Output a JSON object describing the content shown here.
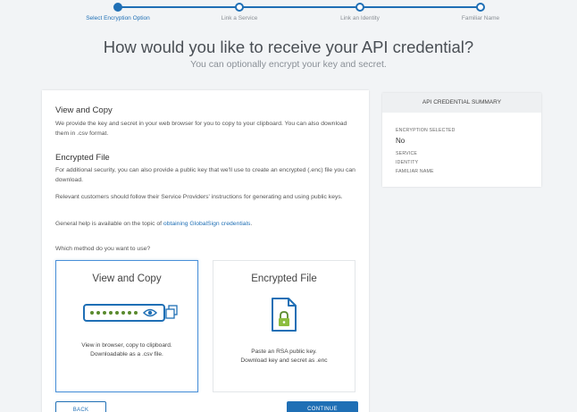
{
  "stepper": {
    "steps": [
      {
        "label": "Select Encryption Option"
      },
      {
        "label": "Link a Service"
      },
      {
        "label": "Link an Identity"
      },
      {
        "label": "Familiar Name"
      }
    ]
  },
  "header": {
    "title": "How would you like to receive your API credential?",
    "subtitle": "You can optionally encrypt your key and secret."
  },
  "main": {
    "view_copy_heading": "View and Copy",
    "view_copy_text": "We provide the key and secret in your web browser for you to copy to your clipboard. You can also download them in .csv format.",
    "encrypted_heading": "Encrypted File",
    "encrypted_text": "For additional security, you can also provide a public key that we'll use to create an encrypted (.enc) file you can download.",
    "relevant_text": "Relevant customers should follow their Service Providers' instructions for generating and using public keys.",
    "help_prefix": "General help is available on the topic of ",
    "help_link": "obtaining GlobalSign credentials",
    "help_suffix": ".",
    "method_question": "Which method do you want to use?",
    "options": [
      {
        "title": "View and Copy",
        "desc_line1": "View in browser, copy to clipboard.",
        "desc_line2": "Downloadable as a .csv file."
      },
      {
        "title": "Encrypted File",
        "desc_line1": "Paste an RSA public key.",
        "desc_line2": "Download key and secret as .enc"
      }
    ],
    "back_label": "BACK",
    "continue_label": "CONTINUE"
  },
  "summary": {
    "title": "API CREDENTIAL SUMMARY",
    "encryption_label": "ENCRYPTION SELECTED",
    "encryption_value": "No",
    "service_label": "SERVICE",
    "identity_label": "IDENTITY",
    "familiar_label": "FAMILIAR NAME"
  },
  "colors": {
    "accent": "#1f6fb5",
    "success": "#5a8a2e"
  }
}
